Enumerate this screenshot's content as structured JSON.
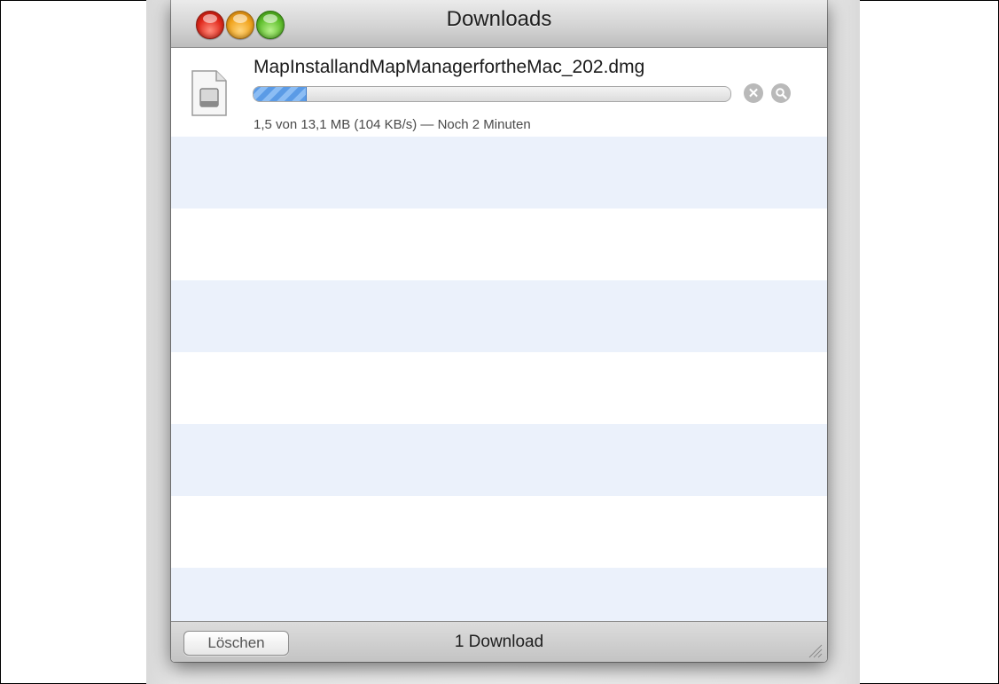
{
  "window": {
    "title": "Downloads",
    "controls": {
      "close_icon": "close-icon",
      "minimize_icon": "minimize-icon",
      "zoom_icon": "zoom-icon"
    }
  },
  "downloads": [
    {
      "file_name": "MapInstallandMapManagerfortheMac_202.dmg",
      "status": "1,5 von 13,1 MB (104 KB/s) — Noch 2 Minuten",
      "progress": 0.11,
      "cancel_icon": "cancel-icon",
      "reveal_icon": "magnifier-icon",
      "file_icon": "disk-image-icon"
    }
  ],
  "footer": {
    "clear_label": "Löschen",
    "count_label": "1 Download"
  },
  "colors": {
    "stripe": "#ebf1fb",
    "progress": "#5b9be6",
    "close": "#e0281b",
    "minimize": "#f0a21b",
    "zoom": "#5fbf2c"
  }
}
